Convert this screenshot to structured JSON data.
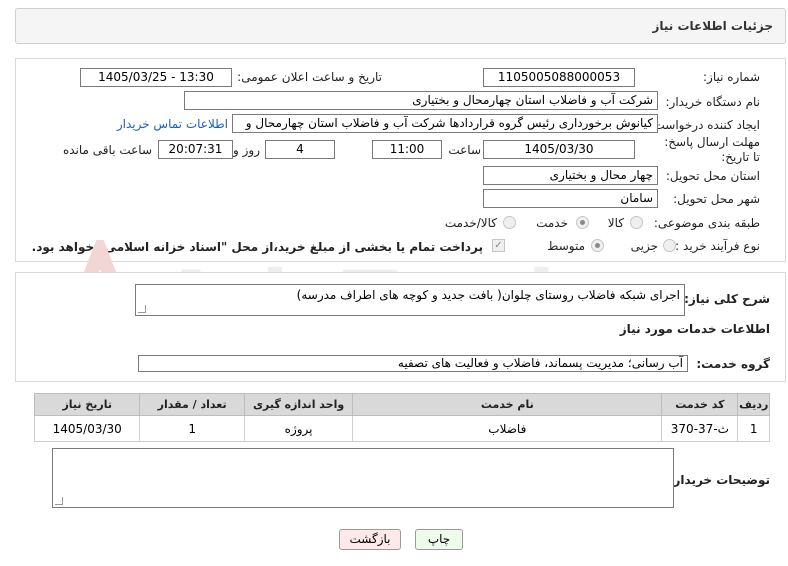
{
  "header": {
    "title": "جزئیات اطلاعات نیاز"
  },
  "fields": {
    "need_number_label": "شماره نیاز:",
    "need_number": "1105005088000053",
    "announce_label": "تاریخ و ساعت اعلان عمومی:",
    "announce_value": "1405/03/25 - 13:30",
    "buyer_org_label": "نام دستگاه خریدار:",
    "buyer_org": "شرکت آب و فاضلاب استان چهارمحال و بختیاری",
    "creator_label": "ایجاد کننده درخواست:",
    "creator": "کیانوش برخورداری رئیس گروه قراردادها شرکت آب و فاضلاب استان چهارمحال و",
    "contact_link": "اطلاعات تماس خریدار",
    "deadline_label": "مهلت ارسال پاسخ: تا تاریخ:",
    "deadline_date": "1405/03/30",
    "time_label": "ساعت",
    "deadline_time": "11:00",
    "days_value": "4",
    "days_label": "روز و",
    "remaining_time": "20:07:31",
    "remaining_label": "ساعت باقی مانده",
    "province_label": "استان محل تحویل:",
    "province": "چهار محال و بختیاری",
    "city_label": "شهر محل تحویل:",
    "city": "سامان",
    "category_label": "طبقه بندی موضوعی:",
    "category_options": [
      "کالا",
      "خدمت",
      "کالا/خدمت"
    ],
    "category_selected": "خدمت",
    "process_label": "نوع فرآیند خرید :",
    "process_options": [
      "جزیی",
      "متوسط"
    ],
    "process_selected": "متوسط",
    "payment_note": "پرداخت تمام یا بخشی از مبلغ خرید،از محل \"اسناد خزانه اسلامی\" خواهد بود."
  },
  "summary": {
    "label": "شرح کلی نیاز:",
    "text": "اجرای شبکه فاضلاب روستای چلوان( بافت جدید و کوچه های اطراف مدرسه)"
  },
  "services_title": "اطلاعات خدمات مورد نیاز",
  "service_group": {
    "label": "گروه خدمت:",
    "value": "آب رسانی؛ مدیریت پسماند، فاضلاب و فعالیت های تصفیه"
  },
  "table": {
    "headers": [
      "ردیف",
      "کد خدمت",
      "نام خدمت",
      "واحد اندازه گیری",
      "تعداد / مقدار",
      "تاریخ نیاز"
    ],
    "rows": [
      [
        "1",
        "ث-37-370",
        "فاضلاب",
        "پروژه",
        "1",
        "1405/03/30"
      ]
    ]
  },
  "buyer_notes": {
    "label": "توضیحات خریدار:",
    "value": ""
  },
  "buttons": {
    "print": "چاپ",
    "back": "بازگشت"
  },
  "watermark": "AriaTender.net"
}
